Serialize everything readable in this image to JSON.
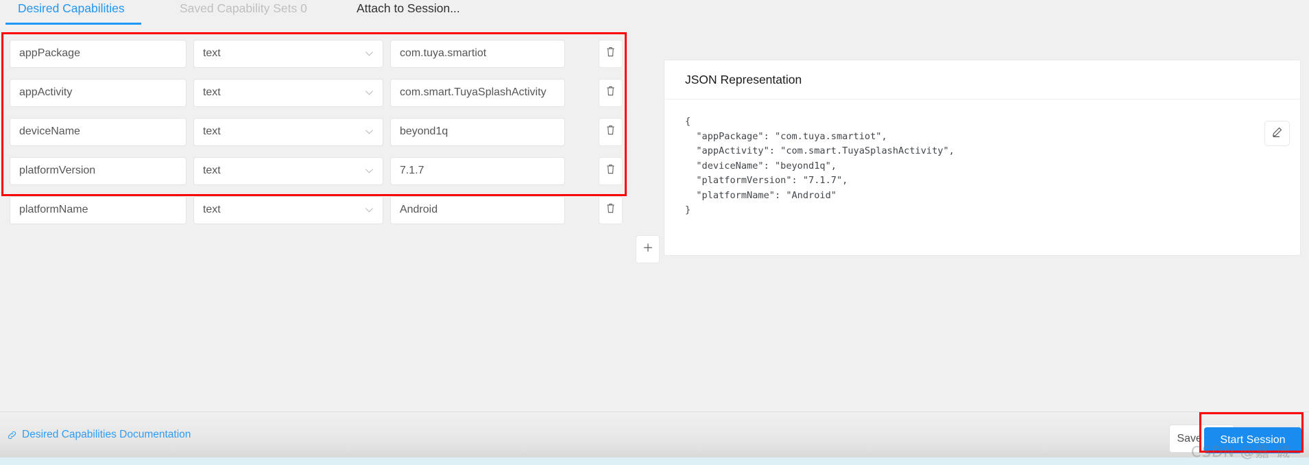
{
  "tabs": [
    {
      "label": "Desired Capabilities",
      "state": "active"
    },
    {
      "label": "Saved Capability Sets 0",
      "state": "disabled"
    },
    {
      "label": "Attach to Session...",
      "state": "normal"
    }
  ],
  "capabilities": {
    "rows": [
      {
        "name": "appPackage",
        "type": "text",
        "value": "com.tuya.smartiot"
      },
      {
        "name": "appActivity",
        "type": "text",
        "value": "com.smart.TuyaSplashActivity"
      },
      {
        "name": "deviceName",
        "type": "text",
        "value": "beyond1q"
      },
      {
        "name": "platformVersion",
        "type": "text",
        "value": "7.1.7"
      },
      {
        "name": "platformName",
        "type": "text",
        "value": "Android"
      }
    ],
    "delete_icon": "trash-icon",
    "add_icon": "plus-icon",
    "type_dropdown_icon": "chevron-down-icon"
  },
  "json_panel": {
    "title": "JSON Representation",
    "edit_icon": "pencil-icon",
    "content": "{\n  \"appPackage\": \"com.tuya.smartiot\",\n  \"appActivity\": \"com.smart.TuyaSplashActivity\",\n  \"deviceName\": \"beyond1q\",\n  \"platformVersion\": \"7.1.7\",\n  \"platformName\": \"Android\"\n}"
  },
  "footer": {
    "doc_link": "Desired Capabilities Documentation",
    "doc_link_icon": "link-icon",
    "save_as_label": "Save As...",
    "start_session_label": "Start Session"
  },
  "watermark": "CSDN @嘉    诚",
  "colors": {
    "accent_blue": "#2196f3",
    "primary_button": "#1a8cf0",
    "annotation_red": "#fb0007",
    "disabled_tab": "#bfbfbf",
    "panel_background": "#f0f0f0"
  }
}
